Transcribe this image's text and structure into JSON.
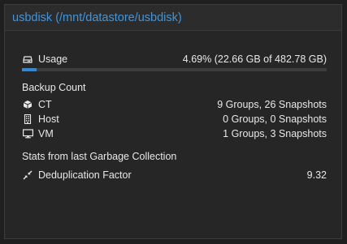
{
  "panel": {
    "title": "usbdisk (/mnt/datastore/usbdisk)"
  },
  "usage": {
    "label": "Usage",
    "value": "4.69% (22.66 GB of 482.78 GB)",
    "fraction": 0.0469,
    "icon": "hdd-icon"
  },
  "backup_count": {
    "title": "Backup Count",
    "rows": [
      {
        "label": "CT",
        "value": "9 Groups, 26 Snapshots",
        "icon": "cube-icon"
      },
      {
        "label": "Host",
        "value": "0 Groups, 0 Snapshots",
        "icon": "building-icon"
      },
      {
        "label": "VM",
        "value": "1 Groups, 3 Snapshots",
        "icon": "desktop-icon"
      }
    ]
  },
  "gc": {
    "title": "Stats from last Garbage Collection",
    "dedup_label": "Deduplication Factor",
    "dedup_value": "9.32",
    "icon": "compress-icon"
  },
  "colors": {
    "accent": "#3d97e0",
    "progress_fill": "#2f8ad6",
    "progress_track": "#3d3d3d",
    "background": "#262626"
  }
}
